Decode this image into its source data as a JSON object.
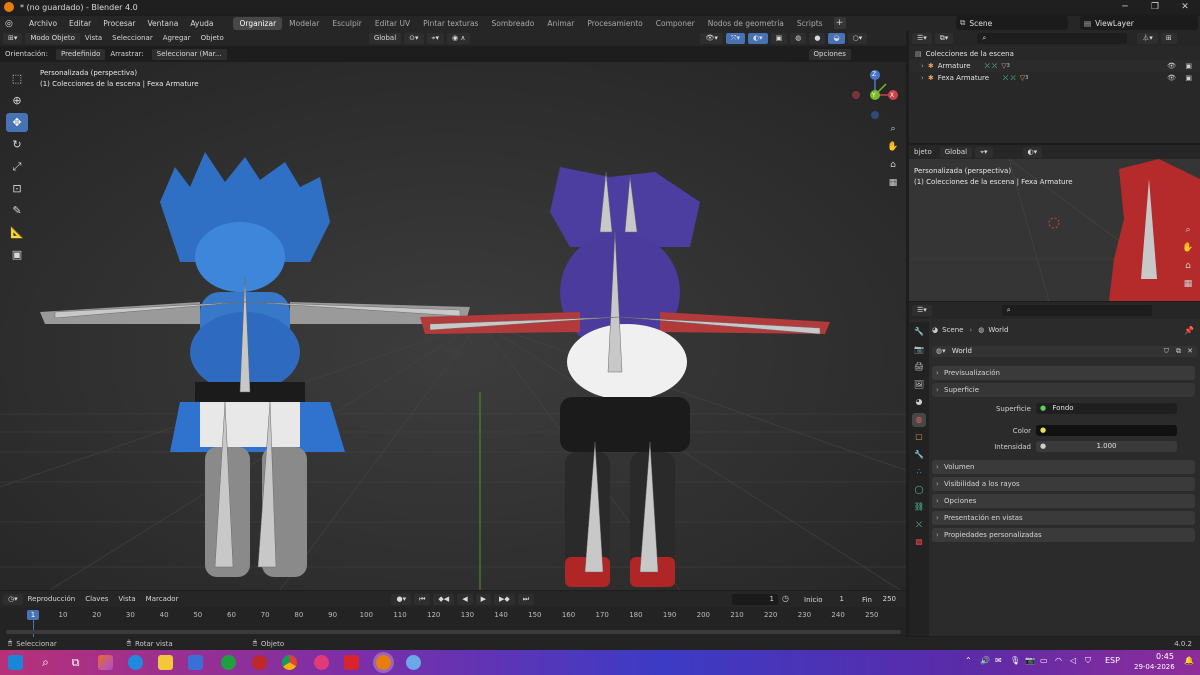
{
  "window": {
    "title": "* (no guardado) - Blender 4.0",
    "min": "─",
    "max": "❐",
    "close": "✕"
  },
  "menu": [
    "Archivo",
    "Editar",
    "Procesar",
    "Ventana",
    "Ayuda"
  ],
  "workspaces": [
    "Organizar",
    "Modelar",
    "Esculpir",
    "Editar UV",
    "Pintar texturas",
    "Sombreado",
    "Animar",
    "Procesamiento",
    "Componer",
    "Nodos de geometría",
    "Scripts"
  ],
  "scene": {
    "name": "Scene",
    "view_layer": "ViewLayer"
  },
  "viewport_header": {
    "mode": "Modo Objeto",
    "view": "Vista",
    "select": "Seleccionar",
    "add": "Agregar",
    "object": "Objeto",
    "orientation_global": "Global",
    "orientation_label": "Orientación:",
    "orientation_value": "Predefinido",
    "drag_label": "Arrastrar:",
    "drag_value": "Seleccionar (Mar...",
    "options": "Opciones"
  },
  "viewport": {
    "persp": "Personalizada (perspectiva)",
    "collection": "(1) Colecciones de la escena | Fexa Armature",
    "gizmo": {
      "z": "Z",
      "y": "Y",
      "x": "X"
    }
  },
  "timeline": {
    "playback": "Reproducción",
    "keys": "Claves",
    "view": "Vista",
    "marker": "Marcador",
    "current_frame": "1",
    "start_label": "Inicio",
    "start": "1",
    "end_label": "Fin",
    "end": "250",
    "ruler": [
      "1",
      "10",
      "20",
      "30",
      "40",
      "50",
      "60",
      "70",
      "80",
      "90",
      "100",
      "110",
      "120",
      "130",
      "140",
      "150",
      "160",
      "170",
      "180",
      "190",
      "200",
      "210",
      "220",
      "230",
      "240",
      "250"
    ]
  },
  "status": {
    "select": "Seleccionar",
    "rotate": "Rotar vista",
    "object": "Objeto",
    "version": "4.0.2"
  },
  "outliner": {
    "root": "Colecciones de la escena",
    "items": [
      {
        "name": "Armature",
        "count": "3"
      },
      {
        "name": "Fexa Armature",
        "count": "3"
      }
    ]
  },
  "mini_viewport": {
    "object": "bjeto",
    "orientation": "Global",
    "persp": "Personalizada (perspectiva)",
    "collection": "(1) Colecciones de la escena | Fexa Armature"
  },
  "properties": {
    "breadcrumb_scene": "Scene",
    "breadcrumb_world": "World",
    "world_name": "World",
    "panels": [
      "Previsualización",
      "Superficie",
      "Volumen",
      "Visibilidad a los rayos",
      "Opciones",
      "Presentación en vistas",
      "Propiedades personalizadas"
    ],
    "surface_label": "Superficie",
    "surface_value": "Fondo",
    "color_label": "Color",
    "intensity_label": "Intensidad",
    "intensity_value": "1.000"
  },
  "taskbar": {
    "lang": "ESP",
    "time": "0:45",
    "date": "29-04-2026"
  },
  "colors": {
    "accent": "#4772b3",
    "active_tab": "#474747",
    "orange": "#e87d0d"
  }
}
